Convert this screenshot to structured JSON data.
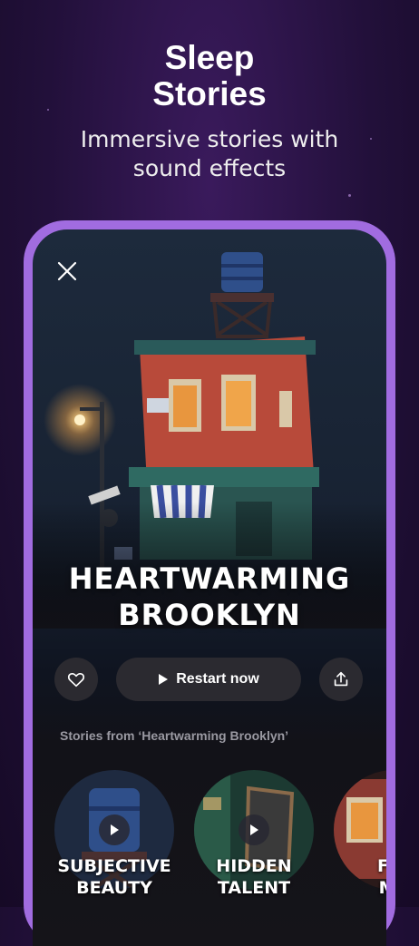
{
  "hero": {
    "title_line1": "Sleep",
    "title_line2": "Stories",
    "subtitle_line1": "Immersive stories with",
    "subtitle_line2": "sound effects"
  },
  "card": {
    "title_line1": "HEARTWARMING",
    "title_line2": "BROOKLYN",
    "close_icon": "close-icon",
    "favorite_icon": "heart-icon",
    "restart_label": "Restart now",
    "share_icon": "share-icon"
  },
  "related": {
    "section_label": "Stories from ‘Heartwarming Brooklyn’",
    "items": [
      {
        "line1": "SUBJECTIVE",
        "line2": "BEAUTY"
      },
      {
        "line1": "HIDDEN",
        "line2": "TALENT"
      },
      {
        "line1": "FIN",
        "line2": "MY"
      }
    ]
  },
  "colors": {
    "background": "#22103a",
    "phone_frame": "#a16ce0",
    "button_bg": "#2b2a30",
    "section_label": "#9a99a2"
  }
}
